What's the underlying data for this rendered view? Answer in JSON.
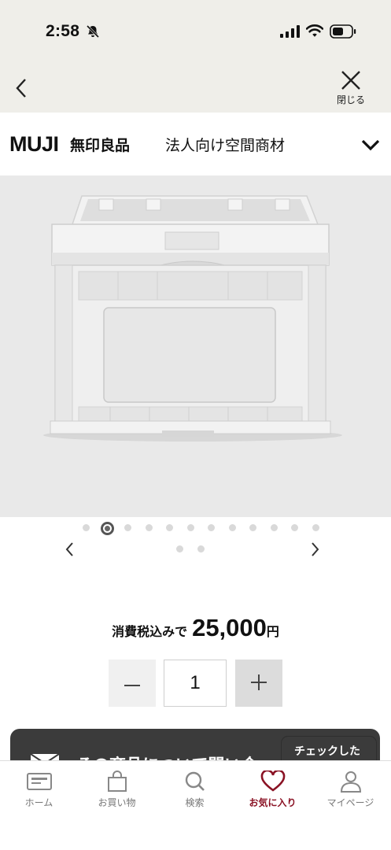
{
  "status_bar": {
    "time": "2:58"
  },
  "nav": {
    "close_label": "閉じる"
  },
  "brand": {
    "logo": "MUJI",
    "name_jp": "無印良品",
    "subtitle": "法人向け空間商材"
  },
  "carousel": {
    "dot_count": 12,
    "second_row_dots": 2,
    "active_index": 1
  },
  "price": {
    "label": "消費税込みで",
    "value": "25,000",
    "unit": "円"
  },
  "quantity": {
    "minus_label": "−",
    "value": "1",
    "plus_label": "+"
  },
  "inquiry": {
    "text": "その商品について問い合",
    "badge": "チェックした"
  },
  "tabs": [
    {
      "label": "ホーム",
      "icon": "card-icon"
    },
    {
      "label": "お買い物",
      "icon": "bag-icon"
    },
    {
      "label": "検索",
      "icon": "search-icon"
    },
    {
      "label": "お気に入り",
      "icon": "heart-icon"
    },
    {
      "label": "マイページ",
      "icon": "person-icon"
    }
  ],
  "colors": {
    "accent": "#8a1224",
    "header_bg": "#efeee9",
    "image_bg": "#e9e9e9",
    "dark_button": "#3b3b3b"
  }
}
